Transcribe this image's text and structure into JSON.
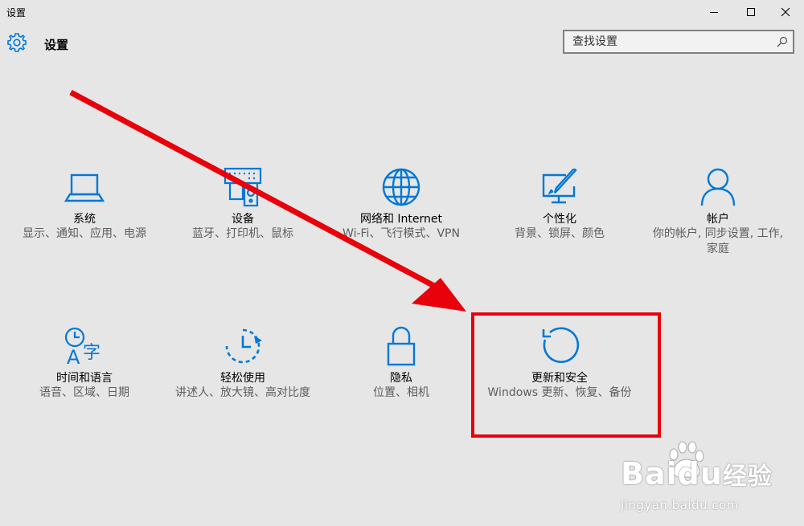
{
  "window": {
    "title": "设置",
    "controls": [
      "minimize-icon",
      "maximize-icon",
      "close-icon"
    ]
  },
  "header": {
    "icon": "gear-icon",
    "title": "设置"
  },
  "search": {
    "placeholder": "查找设置",
    "value": "",
    "icon": "search-icon"
  },
  "accent_color": "#0078d7",
  "highlight_color": "#e8000b",
  "tiles": [
    {
      "name": "系统",
      "desc": "显示、通知、应用、电源",
      "icon": "laptop-icon"
    },
    {
      "name": "设备",
      "desc": "蓝牙、打印机、鼠标",
      "icon": "devices-icon"
    },
    {
      "name": "网络和 Internet",
      "desc": "Wi-Fi、飞行模式、VPN",
      "icon": "globe-icon"
    },
    {
      "name": "个性化",
      "desc": "背景、锁屏、颜色",
      "icon": "personalization-icon"
    },
    {
      "name": "帐户",
      "desc": "你的帐户, 同步设置, 工作, 家庭",
      "icon": "person-icon"
    },
    {
      "name": "时间和语言",
      "desc": "语音、区域、日期",
      "icon": "time-language-icon"
    },
    {
      "name": "轻松使用",
      "desc": "讲述人、放大镜、高对比度",
      "icon": "ease-of-access-icon"
    },
    {
      "name": "隐私",
      "desc": "位置、相机",
      "icon": "lock-icon"
    },
    {
      "name": "更新和安全",
      "desc": "Windows 更新、恢复、备份",
      "icon": "update-icon"
    }
  ],
  "watermark": {
    "brand": "Bai",
    "brand_suffix": "du",
    "brand_cn": "经验",
    "url": "jingyan.baidu.com"
  }
}
